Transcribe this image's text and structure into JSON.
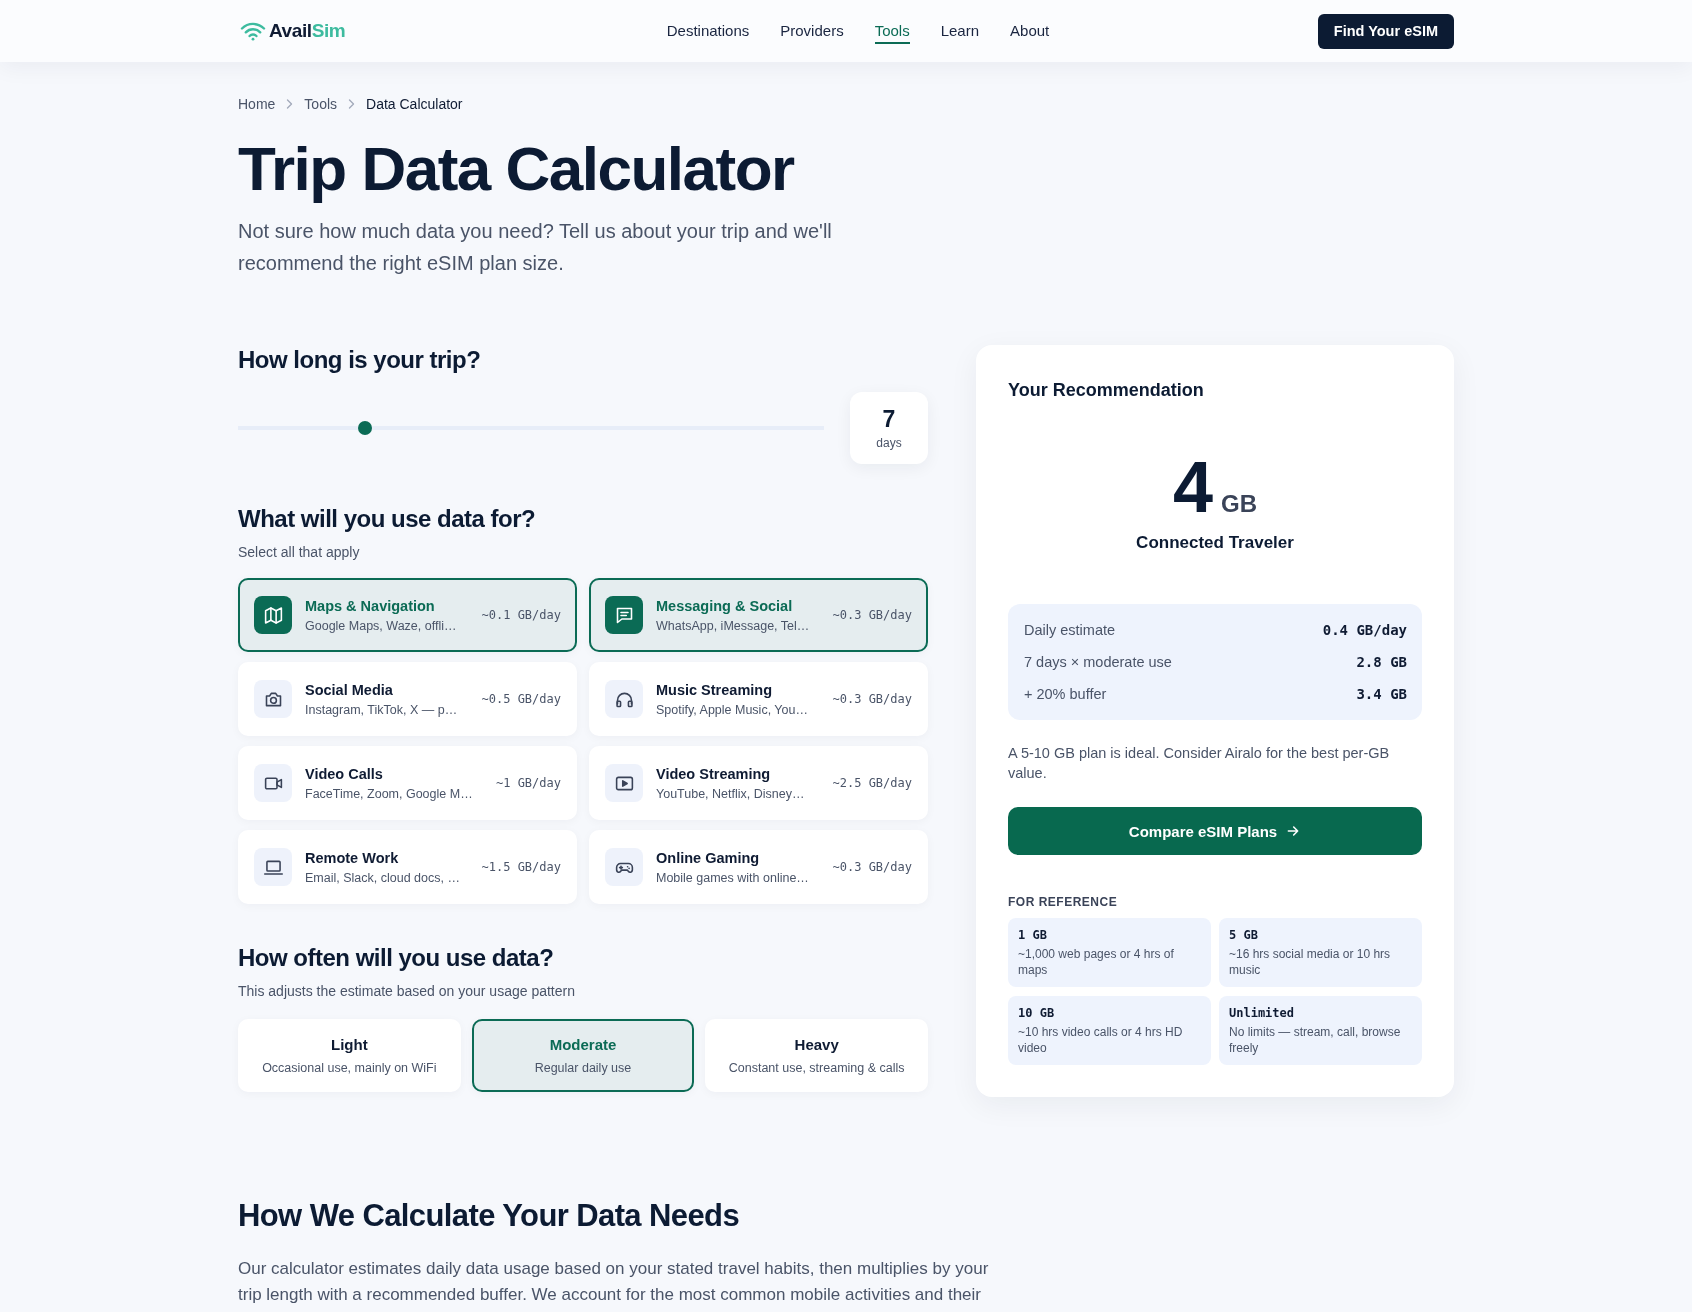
{
  "header": {
    "logo": {
      "name": "Avail",
      "accent": "Sim"
    },
    "nav": [
      {
        "label": "Destinations",
        "selected": false
      },
      {
        "label": "Providers",
        "selected": false
      },
      {
        "label": "Tools",
        "selected": true
      },
      {
        "label": "Learn",
        "selected": false
      },
      {
        "label": "About",
        "selected": false
      }
    ],
    "cta": "Find Your eSIM"
  },
  "breadcrumb": [
    {
      "label": "Home",
      "current": false
    },
    {
      "label": "Tools",
      "current": false
    },
    {
      "label": "Data Calculator",
      "current": true
    }
  ],
  "page": {
    "title": "Trip Data Calculator",
    "intro": "Not sure how much data you need? Tell us about your trip and we'll recommend the right eSIM plan size."
  },
  "trip": {
    "heading": "How long is your trip?",
    "slider": {
      "level": 0.21
    },
    "days": {
      "value": "7",
      "unit": "days"
    }
  },
  "activities": {
    "heading": "What will you use data for?",
    "hint": "Select all that apply",
    "items": [
      {
        "title": "Maps & Navigation",
        "detail": "Google Maps, Waze, offli…",
        "rate": "~0.1 GB/day",
        "selected": true
      },
      {
        "title": "Messaging & Social",
        "detail": "WhatsApp, iMessage, Tel…",
        "rate": "~0.3 GB/day",
        "selected": true
      },
      {
        "title": "Social Media",
        "detail": "Instagram, TikTok, X — p…",
        "rate": "~0.5 GB/day",
        "selected": false
      },
      {
        "title": "Music Streaming",
        "detail": "Spotify, Apple Music, You…",
        "rate": "~0.3 GB/day",
        "selected": false
      },
      {
        "title": "Video Calls",
        "detail": "FaceTime, Zoom, Google M…",
        "rate": "~1 GB/day",
        "selected": false
      },
      {
        "title": "Video Streaming",
        "detail": "YouTube, Netflix, Disney…",
        "rate": "~2.5 GB/day",
        "selected": false
      },
      {
        "title": "Remote Work",
        "detail": "Email, Slack, cloud docs, …",
        "rate": "~1.5 GB/day",
        "selected": false
      },
      {
        "title": "Online Gaming",
        "detail": "Mobile games with online…",
        "rate": "~0.3 GB/day",
        "selected": false
      }
    ]
  },
  "usage": {
    "heading": "How often will you use data?",
    "hint": "This adjusts the estimate based on your usage pattern",
    "options": [
      {
        "label": "Light",
        "detail": "Occasional use, mainly on WiFi",
        "selected": false
      },
      {
        "label": "Moderate",
        "detail": "Regular daily use",
        "selected": true
      },
      {
        "label": "Heavy",
        "detail": "Constant use, streaming & calls",
        "selected": false
      }
    ]
  },
  "recommendation": {
    "heading": "Your Recommendation",
    "amount": "4",
    "unit": "GB",
    "profile": "Connected Traveler",
    "breakdown": [
      {
        "label": "Daily estimate",
        "value": "0.4 GB/day"
      },
      {
        "label": "7 days × moderate use",
        "value": "2.8 GB"
      },
      {
        "label": "+ 20% buffer",
        "value": "3.4 GB"
      }
    ],
    "note": "A 5-10 GB plan is ideal. Consider Airalo for the best per-GB value.",
    "button": "Compare eSIM Plans",
    "reference": {
      "heading": "FOR REFERENCE",
      "items": [
        {
          "size": "1 GB",
          "detail": "~1,000 web pages or 4 hrs of maps"
        },
        {
          "size": "5 GB",
          "detail": "~16 hrs social media or 10 hrs music"
        },
        {
          "size": "10 GB",
          "detail": "~10 hrs video calls or 4 hrs HD video"
        },
        {
          "size": "Unlimited",
          "detail": "No limits — stream, call, browse freely"
        }
      ]
    }
  },
  "method": {
    "heading": "How We Calculate Your Data Needs",
    "text": "Our calculator estimates daily data usage based on your stated travel habits, then multiplies by your trip length with a recommended buffer. We account for the most common mobile activities and their"
  }
}
